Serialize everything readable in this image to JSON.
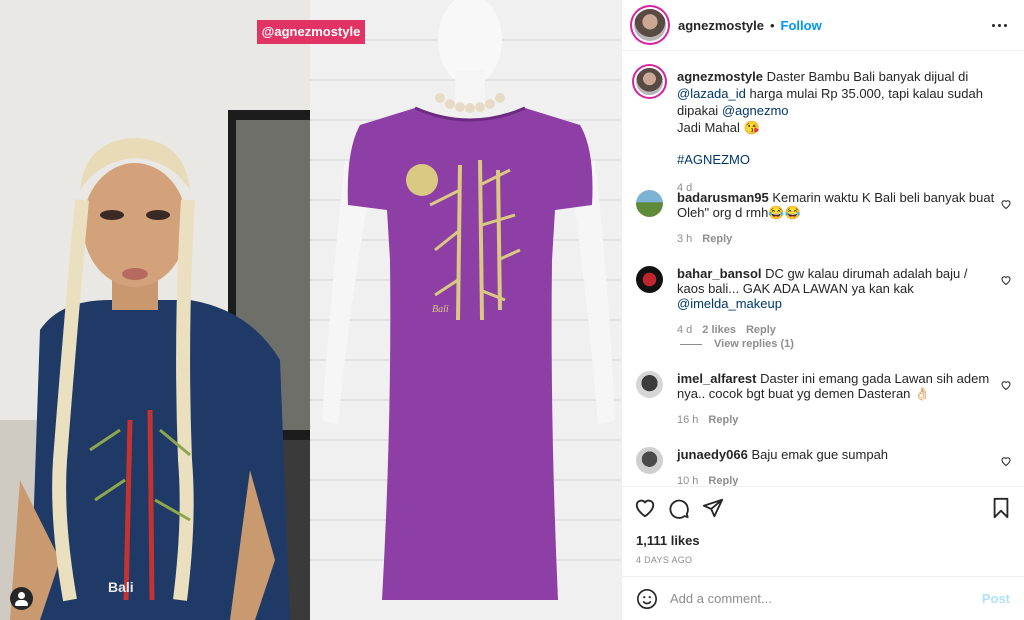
{
  "media": {
    "watermark": "@agnezmostyle"
  },
  "header": {
    "username": "agnezmostyle",
    "separator": "•",
    "follow_label": "Follow",
    "more_icon": "more-horizontal-icon"
  },
  "caption": {
    "username": "agnezmostyle",
    "text_1": "Daster Bambu Bali banyak dijual di",
    "mention_1": "@lazada_id",
    "text_2": "harga mulai Rp 35.000, tapi kalau sudah dipakai",
    "mention_2": "@agnezmo",
    "text_3": "Jadi Mahal 😘",
    "hashtag": "#AGNEZMO",
    "time": "4 d"
  },
  "comments": [
    {
      "username": "badarusman95",
      "text": "Kemarin waktu K Bali beli banyak buat Oleh\" org d rmh😂😂",
      "time": "3 h",
      "reply": "Reply"
    },
    {
      "username": "bahar_bansol",
      "text": "DC gw kalau dirumah adalah baju / kaos bali... GAK ADA LAWAN ya kan kak",
      "mention": "@imelda_makeup",
      "time": "4 d",
      "likes": "2 likes",
      "reply": "Reply"
    },
    {
      "username": "imel_alfarest",
      "text": "Daster ini emang gada Lawan sih adem nya.. cocok bgt buat yg demen Dasteran 👌🏻",
      "time": "16 h",
      "reply": "Reply"
    },
    {
      "username": "junaedy066",
      "text": "Baju emak gue sumpah",
      "time": "10 h",
      "reply": "Reply"
    }
  ],
  "view_replies": "View replies (1)",
  "actions": {
    "likes": "1,111 likes",
    "date": "4 DAYS AGO"
  },
  "add_comment": {
    "placeholder": "Add a comment...",
    "post_label": "Post"
  },
  "colors": {
    "accent": "#0095f6",
    "watermark_bg": "#e23464",
    "dress": "#8e3fa6"
  }
}
